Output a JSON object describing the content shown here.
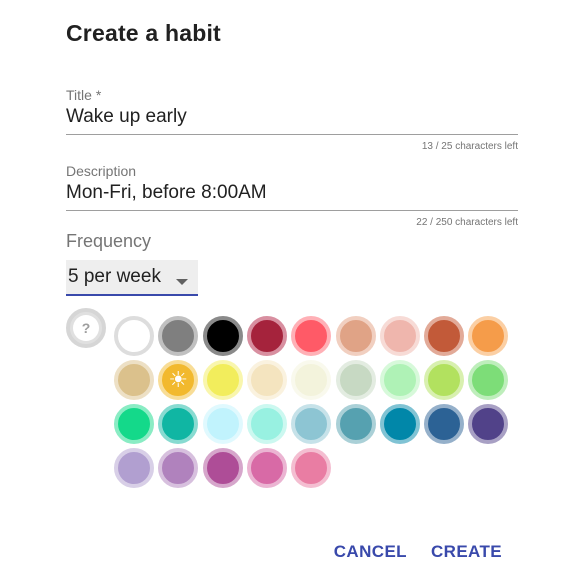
{
  "dialog": {
    "title": "Create a habit"
  },
  "form": {
    "title_field": {
      "label": "Title *",
      "value": "Wake up early",
      "counter": "13 / 25 characters left"
    },
    "description_field": {
      "label": "Description",
      "value": "Mon-Fri, before 8:00AM",
      "counter": "22 / 250 characters left"
    },
    "frequency": {
      "label": "Frequency",
      "selected": "5 per week"
    }
  },
  "color_picker": {
    "help_label": "?",
    "selected_index": 10,
    "selected_icon": "sun-icon",
    "colors": [
      {
        "fill": "#ffffff",
        "ring": "#dddddd"
      },
      {
        "fill": "#7f7f7f",
        "ring": "#c0c0c0"
      },
      {
        "fill": "#000000",
        "ring": "#8a8a8a"
      },
      {
        "fill": "#a5233c",
        "ring": "#d88fa0"
      },
      {
        "fill": "#ff5a67",
        "ring": "#ffb0b6"
      },
      {
        "fill": "#e0a386",
        "ring": "#f1cfc0"
      },
      {
        "fill": "#efb6ad",
        "ring": "#f7dbd6"
      },
      {
        "fill": "#c25a39",
        "ring": "#e2aa98"
      },
      {
        "fill": "#f59c4a",
        "ring": "#fbcfa4"
      },
      {
        "fill": "#dbc18c",
        "ring": "#ede0c5"
      },
      {
        "fill": "#f2b92e",
        "ring": "#f8dd97"
      },
      {
        "fill": "#f2ed5c",
        "ring": "#f9f6ad"
      },
      {
        "fill": "#f4e4bf",
        "ring": "#faf2df"
      },
      {
        "fill": "#f3f3dc",
        "ring": "#f9f9ed"
      },
      {
        "fill": "#c7d9c3",
        "ring": "#e3ece1"
      },
      {
        "fill": "#aff2b6",
        "ring": "#d7f9da"
      },
      {
        "fill": "#b2e15f",
        "ring": "#d8f0af"
      },
      {
        "fill": "#7ddd78",
        "ring": "#beeebb"
      },
      {
        "fill": "#14d98a",
        "ring": "#8aecc4"
      },
      {
        "fill": "#10b6a3",
        "ring": "#88dbd1"
      },
      {
        "fill": "#c1f3fd",
        "ring": "#e0f9fe"
      },
      {
        "fill": "#98f1e1",
        "ring": "#ccf8f0"
      },
      {
        "fill": "#8dc5d3",
        "ring": "#c6e2e9"
      },
      {
        "fill": "#56a1b0",
        "ring": "#aad0d7"
      },
      {
        "fill": "#0187a9",
        "ring": "#80c3d4"
      },
      {
        "fill": "#2c6295",
        "ring": "#95b0ca"
      },
      {
        "fill": "#514289",
        "ring": "#a8a0c4"
      },
      {
        "fill": "#b19fd0",
        "ring": "#d8cfe7"
      },
      {
        "fill": "#b082bd",
        "ring": "#d7c0de"
      },
      {
        "fill": "#ae4d97",
        "ring": "#d6a6cb"
      },
      {
        "fill": "#d86aa6",
        "ring": "#ebb4d2"
      },
      {
        "fill": "#e97da3",
        "ring": "#f4bed1"
      }
    ]
  },
  "actions": {
    "cancel_label": "CANCEL",
    "create_label": "CREATE"
  }
}
